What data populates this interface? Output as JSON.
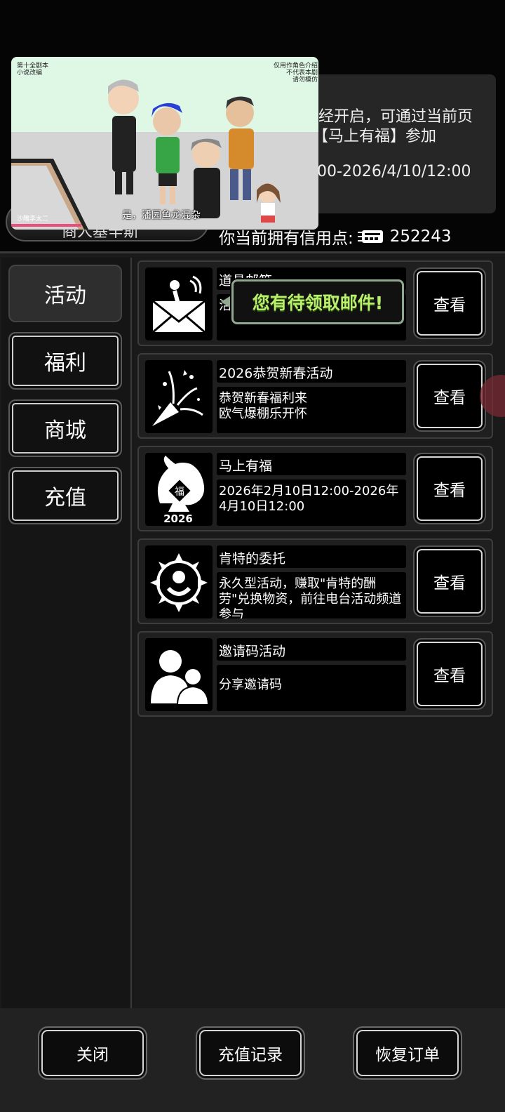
{
  "notice": {
    "line1": "经开启，可通过当前页",
    "line2": "【马上有福】参加",
    "line3": "00-2026/4/10/12:00"
  },
  "merchant": {
    "name": "商人基辛斯"
  },
  "credit": {
    "label": "你当前拥有信用点:",
    "value": "252243"
  },
  "video": {
    "corner_left": "第十全剧本\n小说改编",
    "corner_right": "仅用作角色介绍\n不代表本剧\n请勿模仿",
    "subtitle": "是，潘园鱼龙混杂",
    "channel": "沙雕李太二"
  },
  "sidebar": {
    "items": [
      {
        "label": "活动",
        "active": true
      },
      {
        "label": "福利",
        "active": false
      },
      {
        "label": "商城",
        "active": false
      },
      {
        "label": "充值",
        "active": false
      }
    ]
  },
  "activities": [
    {
      "title": "道具邮箱",
      "desc": "活",
      "view": "查看",
      "icon": "mail-icon"
    },
    {
      "title": "2026恭贺新春活动",
      "desc": "恭贺新春福利来\n欧气爆棚乐开怀",
      "view": "查看",
      "icon": "party-popper-icon"
    },
    {
      "title": "马上有福",
      "desc": "2026年2月10日12:00-2026年4月10日12:00",
      "view": "查看",
      "icon": "horse-fortune-icon"
    },
    {
      "title": "肯特的委托",
      "desc": "永久型活动，赚取\"肯特的酬劳\"兑换物资，前往电台活动频道参与",
      "view": "查看",
      "icon": "kent-emblem-icon"
    },
    {
      "title": "邀请码活动",
      "desc": "分享邀请码",
      "view": "查看",
      "icon": "users-icon"
    }
  ],
  "icon_labels": {
    "horse_year": "2026",
    "horse_char": "福"
  },
  "mail_bubble": "您有待领取邮件!",
  "bottom": {
    "close": "关闭",
    "history": "充值记录",
    "restore": "恢复订单"
  },
  "colors": {
    "bubble_text": "#b9f06b",
    "bubble_border": "#8fa88f",
    "progress": "#e84f7d"
  }
}
